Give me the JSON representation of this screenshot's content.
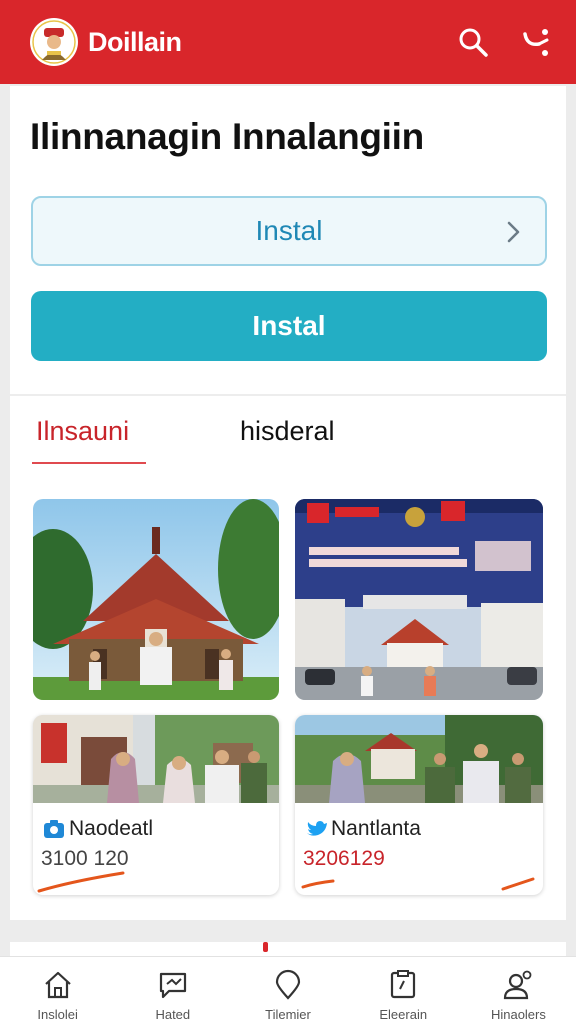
{
  "header": {
    "app_title": "Doillain",
    "actions": [
      {
        "icon": "search-icon"
      },
      {
        "icon": "share-icon"
      }
    ]
  },
  "main": {
    "headline": "Ilinnanagin Innalangiin",
    "primary_buttons": [
      {
        "label": "Instal",
        "style": "outline",
        "trailing_icon": "chevron-right-icon"
      },
      {
        "label": "Instal",
        "style": "filled"
      }
    ],
    "tabs": [
      {
        "label": "Ilnsauni",
        "active": true
      },
      {
        "label": "hisderal",
        "active": false
      }
    ],
    "posts": [
      {
        "title": "Naodeatl",
        "number": "3100 120",
        "icon": "camera-icon"
      },
      {
        "title": "Nantlanta",
        "number": "3206129",
        "icon": "bird-icon"
      }
    ]
  },
  "bottom_nav": [
    {
      "label": "Inslolei",
      "icon": "home-icon"
    },
    {
      "label": "Hated",
      "icon": "chat-icon"
    },
    {
      "label": "Tilemier",
      "icon": "location-icon"
    },
    {
      "label": "Eleerain",
      "icon": "document-icon"
    },
    {
      "label": "Hinaolers",
      "icon": "profile-icon"
    }
  ],
  "colors": {
    "brand_red": "#d9262b",
    "accent_teal": "#23aec4",
    "outline_blue": "#9ed3e6"
  }
}
